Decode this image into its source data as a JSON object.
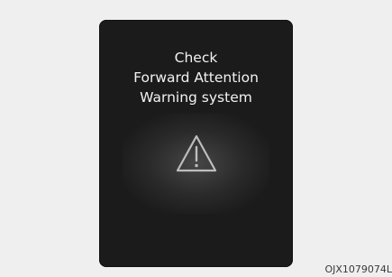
{
  "display": {
    "message_lines": [
      "Check",
      "Forward Attention",
      "Warning system"
    ],
    "icon": "warning-triangle-icon"
  },
  "reference_code": "OJX1079074L",
  "colors": {
    "panel_background": "#1b1b1b",
    "text": "#f2f2f2",
    "icon_stroke": "#bdbdbd",
    "page_background": "#efefef"
  }
}
